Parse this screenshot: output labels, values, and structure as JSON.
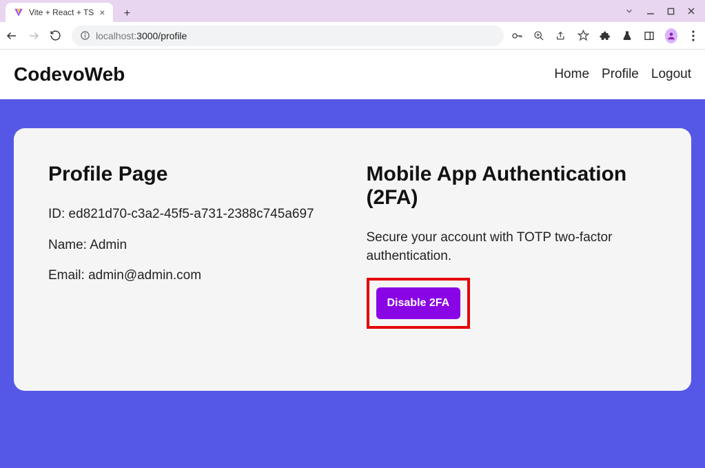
{
  "browser": {
    "tab_title": "Vite + React + TS",
    "url_host_prefix": "localhost:",
    "url_host_suffix": "3000/profile"
  },
  "app": {
    "brand": "CodevoWeb",
    "nav": {
      "home": "Home",
      "profile": "Profile",
      "logout": "Logout"
    }
  },
  "profile": {
    "heading": "Profile Page",
    "id_label": "ID: ed821d70-c3a2-45f5-a731-2388c745a697",
    "name_label": "Name: Admin",
    "email_label": "Email: admin@admin.com"
  },
  "twofa": {
    "heading": "Mobile App Authentication (2FA)",
    "desc": "Secure your account with TOTP two-factor authentication.",
    "button": "Disable 2FA"
  }
}
